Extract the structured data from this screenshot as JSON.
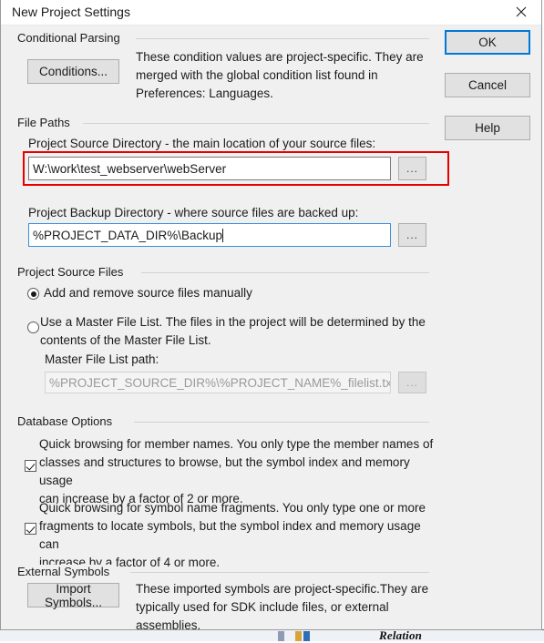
{
  "window": {
    "title": "New Project Settings",
    "close_icon": "close-icon"
  },
  "action_buttons": {
    "ok": "OK",
    "cancel": "Cancel",
    "help": "Help"
  },
  "conditional_parsing": {
    "group_title": "Conditional Parsing",
    "conditions_button": "Conditions...",
    "description_line1": "These condition values are project-specific.  They are",
    "description_line2": "merged with the global condition list found in",
    "description_line3": "Preferences: Languages."
  },
  "file_paths": {
    "group_title": "File Paths",
    "source_dir_label": "Project Source Directory - the main location of your source files:",
    "source_dir_value": "W:\\work\\test_webserver\\webServer",
    "source_dir_browse": "...",
    "backup_dir_label": "Project Backup Directory - where source files are backed up:",
    "backup_dir_value": "%PROJECT_DATA_DIR%\\Backup",
    "backup_dir_browse": "..."
  },
  "project_source_files": {
    "group_title": "Project Source Files",
    "radio_manual_label": "Add and remove source files manually",
    "radio_manual_selected": true,
    "radio_masterlist_line1": "Use a Master File List. The files in the project will be determined by the",
    "radio_masterlist_line2": "contents of the Master File List.",
    "radio_masterlist_selected": false,
    "master_path_label": "Master File List path:",
    "master_path_value": "%PROJECT_SOURCE_DIR%\\%PROJECT_NAME%_filelist.txt",
    "master_path_browse": "..."
  },
  "database_options": {
    "group_title": "Database Options",
    "option1_checked": true,
    "option1_line1": "Quick browsing for member names.  You only type the member names of",
    "option1_line2": "classes and structures to browse, but the symbol index and memory usage",
    "option1_line3": "can increase by a factor of 2 or more.",
    "option2_checked": true,
    "option2_line1": "Quick browsing for symbol name fragments.  You only type one or more",
    "option2_line2": "fragments to locate symbols, but the symbol index and memory usage can",
    "option2_line3": "increase by a factor of 4 or more."
  },
  "external_symbols": {
    "group_title": "External Symbols",
    "import_button": "Import Symbols...",
    "description_line1": "These imported symbols are project-specific.They are",
    "description_line2": "typically used for SDK include files, or external assemblies."
  },
  "background": {
    "partial_label": "Relation"
  },
  "colors": {
    "dialog_background": "#f0f0f0",
    "accent_focus": "#0078d7",
    "annotation_highlight": "#e60000",
    "field_background": "#ffffff",
    "button_face": "#e1e1e1"
  }
}
